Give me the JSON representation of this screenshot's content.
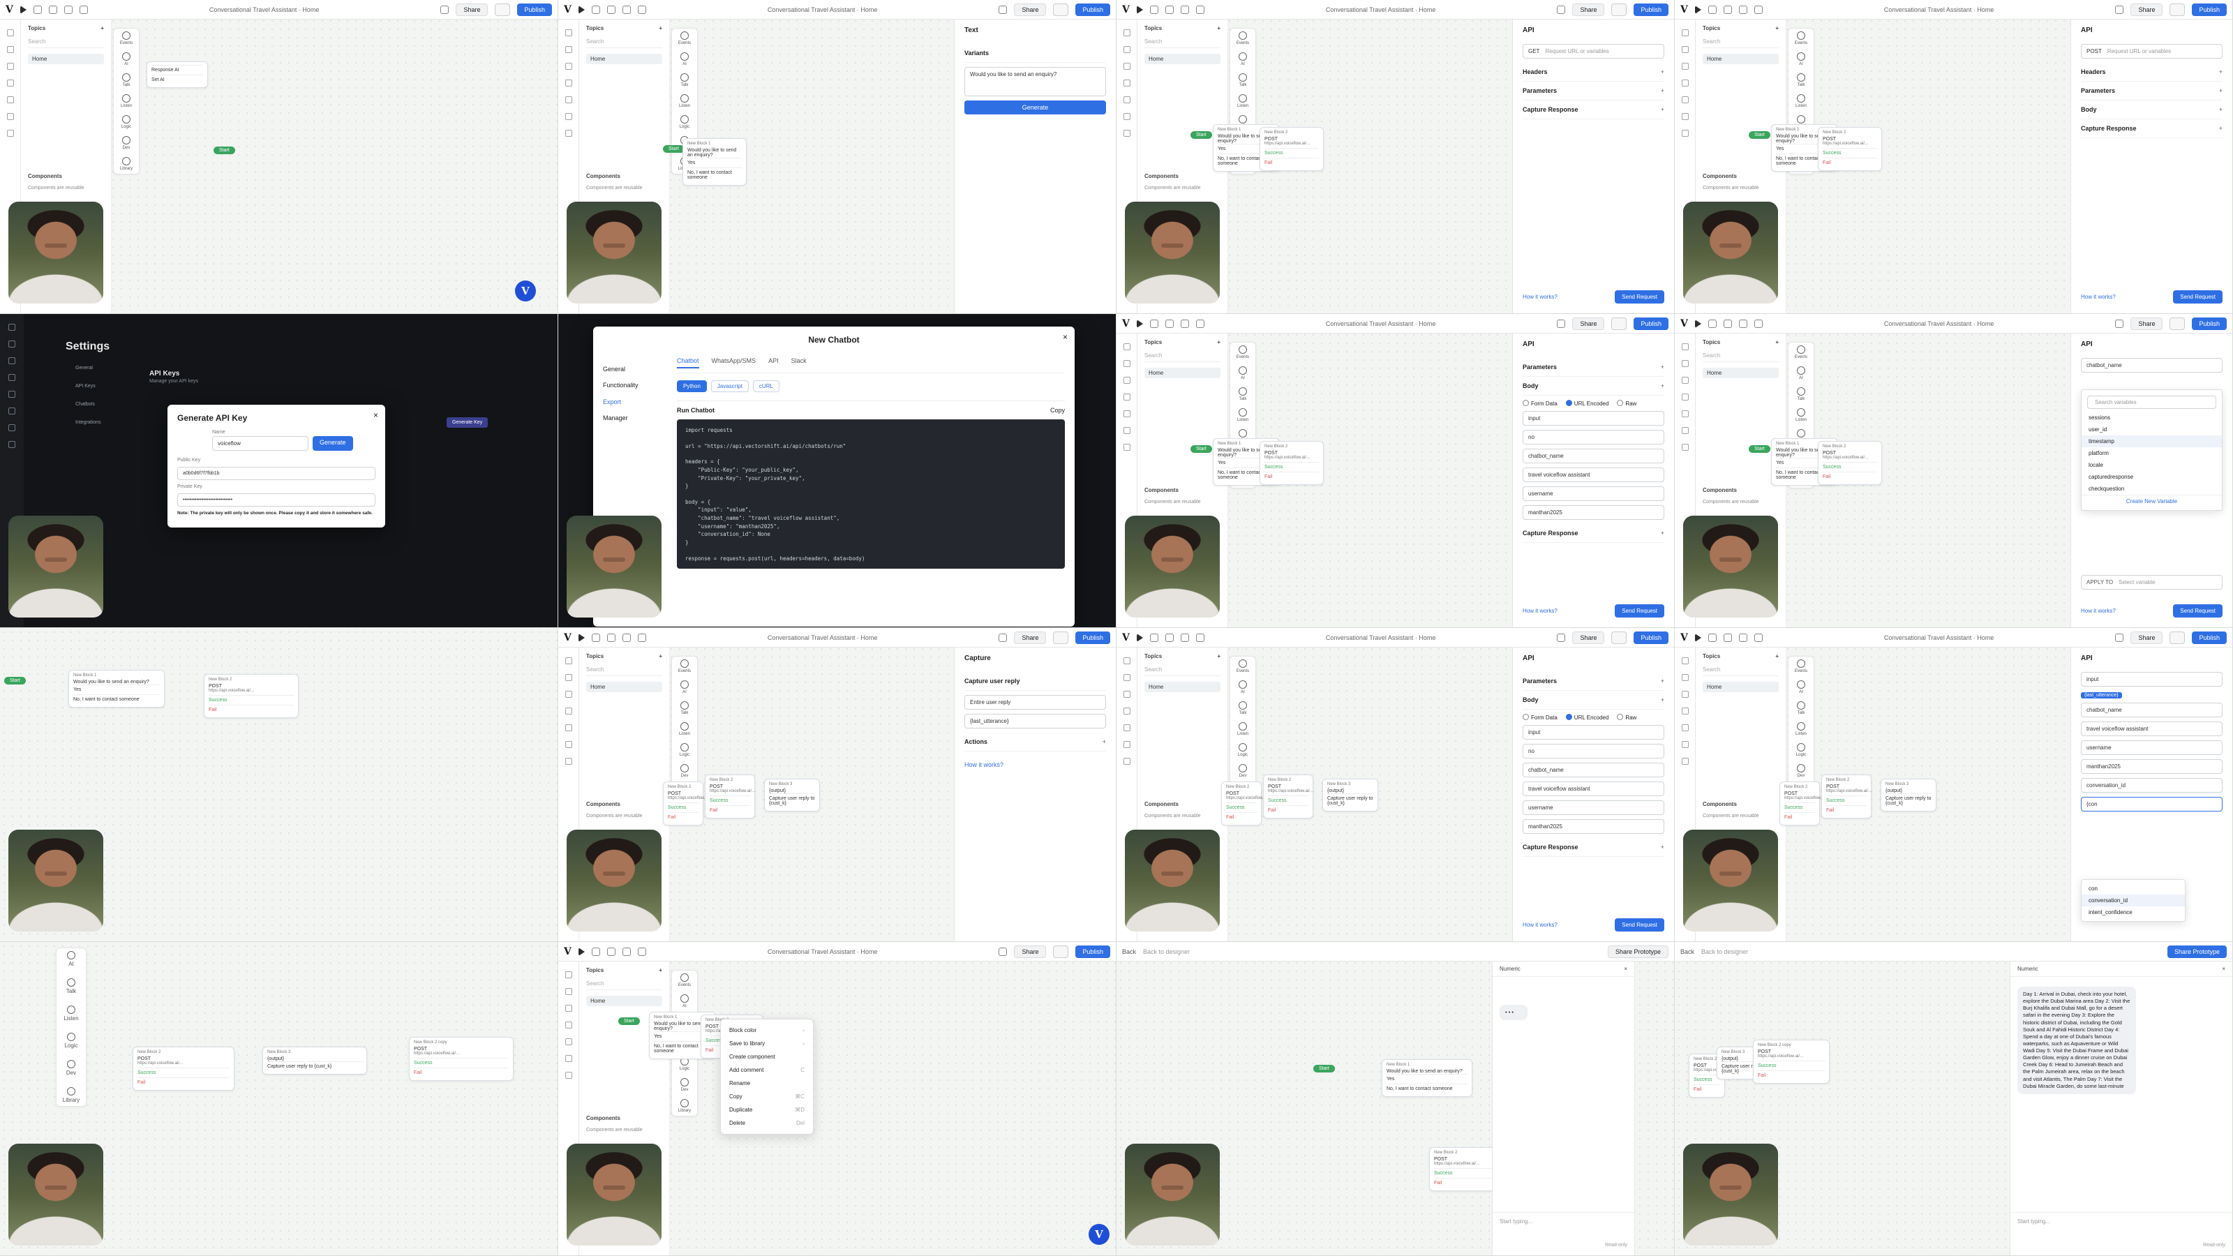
{
  "app": {
    "logo": "V",
    "project_title": "Conversational Travel Assistant",
    "breadcrumb": "Home",
    "share_label": "Share",
    "publish_label": "Publish",
    "share_prototype_label": "Share Prototype",
    "back_label": "Back",
    "back_to_designer": "Back to designer"
  },
  "topics": {
    "heading": "Topics",
    "search_placeholder": "Search",
    "home_label": "Home",
    "components_heading": "Components",
    "components_note": "Components are reusable"
  },
  "steps": [
    "Events",
    "AI",
    "Talk",
    "Listen",
    "Logic",
    "Dev",
    "Library"
  ],
  "ai_menu": [
    "Response AI",
    "Set AI"
  ],
  "nodes": {
    "start": "Start",
    "new_block_1": "New Block 1",
    "new_block_2": "New Block 2",
    "new_block_3": "New Block 3",
    "new_block_copy": "New Block 2 copy",
    "question": "Would you like to send an enquiry?",
    "yes": "Yes",
    "no": "No, I want to contact someone",
    "post": "POST",
    "post_url": "https://api.voiceflow.ai/...",
    "success": "Success",
    "fail": "Fail",
    "capture_text": "Capture user reply to {cust_k}",
    "output_label": "{output}"
  },
  "text_panel": {
    "title": "Text",
    "variants_label": "Variants",
    "message": "Would you like to send an enquiry?",
    "generate_label": "Generate"
  },
  "api_panel": {
    "title": "API",
    "method": "GET",
    "method_post": "POST",
    "url_placeholder": "Request URL or variables",
    "headers_label": "Headers",
    "parameters_label": "Parameters",
    "body_label": "Body",
    "capture_response_label": "Capture Response",
    "how_it_works": "How it works?",
    "send_request": "Send Request",
    "body_types": [
      "Form Data",
      "URL Encoded",
      "Raw"
    ],
    "fields": [
      {
        "key": "input",
        "value": "no"
      },
      {
        "key": "chatbot_name",
        "value": "travel voiceflow assistant"
      },
      {
        "key": "username",
        "value": "manthan2025"
      }
    ],
    "variable_search_placeholder": "Search variables",
    "variables": [
      "sessions",
      "user_id",
      "timestamp",
      "platform",
      "locale",
      "capturedresponse",
      "checkquestion"
    ],
    "create_variable": "Create New Variable",
    "apply_to_label": "APPLY TO",
    "apply_to_placeholder": "Select variable",
    "extra_field": "conversation_id",
    "typed_value": "{con",
    "search_value": "con",
    "suggestions": [
      "conversation_id",
      "intent_confidence"
    ],
    "last_utterance_chip": "{last_utterance}"
  },
  "capture_panel": {
    "title": "Capture",
    "capture_reply_label": "Capture user reply",
    "entire_reply": "Entire user reply",
    "variable": "{last_utterance}",
    "actions_label": "Actions",
    "how_it_works": "How it works?"
  },
  "settings": {
    "title": "Settings",
    "tabs": [
      "General",
      "API Keys",
      "Chatbots",
      "Integrations"
    ],
    "api_keys_heading": "API Keys",
    "api_keys_sub": "Manage your API keys",
    "modal_title": "Generate API Key",
    "name_label": "Name",
    "name_value": "voiceflow",
    "generate_label": "Generate",
    "public_key_label": "Public Key",
    "public_key_value": "a0b0d6f7f7fbb1b",
    "private_key_label": "Private Key",
    "private_key_value": "•••••••••••••••••••••••••••••",
    "note": "Note: The private key will only be shown once. Please copy it and store it somewhere safe.",
    "generate_key_button": "Generate Key"
  },
  "chatbot_modal": {
    "title": "New Chatbot",
    "side": [
      "General",
      "Functionality",
      "Export",
      "Manager"
    ],
    "tabs": [
      "Chatbot",
      "WhatsApp/SMS",
      "API",
      "Slack"
    ],
    "langs": [
      "Python",
      "Javascript",
      "cURL"
    ],
    "run_label": "Run Chatbot",
    "copy_label": "Copy",
    "code_lines": [
      "import requests",
      "",
      "url = \"https://api.vectorshift.ai/api/chatbots/run\"",
      "",
      "headers = {",
      "    \"Public-Key\": \"your_public_key\",",
      "    \"Private-Key\": \"your_private_key\",",
      "}",
      "",
      "body = {",
      "    \"input\": \"value\",",
      "    \"chatbot_name\": \"travel voiceflow assistant\",",
      "    \"username\": \"manthan2025\",",
      "    \"conversation_id\": None",
      "}",
      "",
      "response = requests.post(url, headers=headers, data=body)"
    ]
  },
  "context_menu": [
    {
      "label": "Block color",
      "hint": "›"
    },
    {
      "label": "Save to library",
      "hint": "›"
    },
    {
      "label": "Create component",
      "hint": ""
    },
    {
      "label": "Add comment",
      "hint": "C"
    },
    {
      "label": "Rename",
      "hint": ""
    },
    {
      "label": "Copy",
      "hint": "⌘C"
    },
    {
      "label": "Duplicate",
      "hint": "⌘D"
    },
    {
      "label": "Delete",
      "hint": "Del"
    }
  ],
  "prototype": {
    "header": "Numeric",
    "start_label": "Start",
    "input_placeholder": "Start typing...",
    "read_only": "Read-only",
    "itinerary": "Day 1: Arrival in Dubai, check into your hotel, explore the Dubai Marina area Day 2: Visit the Burj Khalifa and Dubai Mall, go for a desert safari in the evening Day 3: Explore the historic district of Dubai, including the Gold Souk and Al Fahidi Historic District Day 4: Spend a day at one of Dubai's famous waterparks, such as Aquaventure or Wild Wadi Day 5: Visit the Dubai Frame and Dubai Garden Glow, enjoy a dinner cruise on Dubai Creek Day 6: Head to Jumeirah Beach and the Palm Jumeirah area, relax on the beach and visit Atlantis, The Palm Day 7: Visit the Dubai Miracle Garden, do some last-minute"
  },
  "colors": {
    "brand": "#2f6fe4",
    "start_green": "#3aa55c",
    "dark_bg": "#121417"
  }
}
